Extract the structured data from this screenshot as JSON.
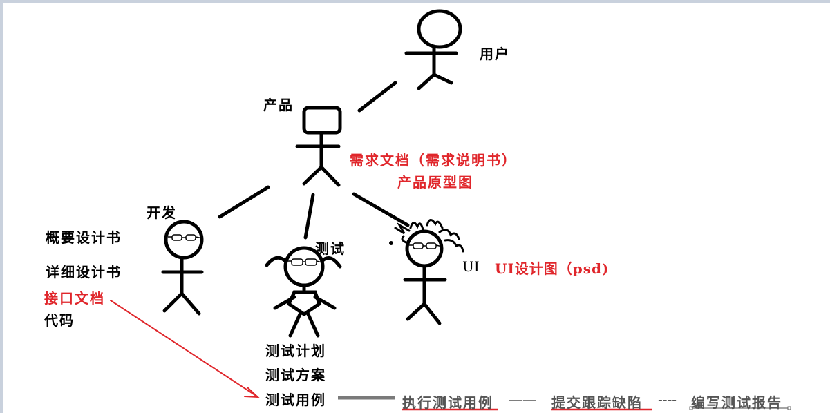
{
  "roles": {
    "user": "用户",
    "product": "产品",
    "dev": "开发",
    "test": "测试",
    "ui": "UI"
  },
  "product_docs": {
    "line1": "需求文档（需求说明书）",
    "line2": "产品原型图"
  },
  "ui_doc": "UI设计图（psd)",
  "dev_docs": {
    "item1": "概要设计书",
    "item2": "详细设计书",
    "item3": "接口文档",
    "item4": "代码"
  },
  "test_docs": {
    "item1": "测试计划",
    "item2": "测试方案",
    "item3": "测试用例"
  },
  "flow": {
    "step1": "执行测试用例",
    "sep1": "——",
    "step2": "提交跟踪缺陷",
    "sep2": "----",
    "step3": "编写测试报告"
  },
  "colors": {
    "red": "#e0262b",
    "black": "#000000",
    "gray": "#555555"
  }
}
